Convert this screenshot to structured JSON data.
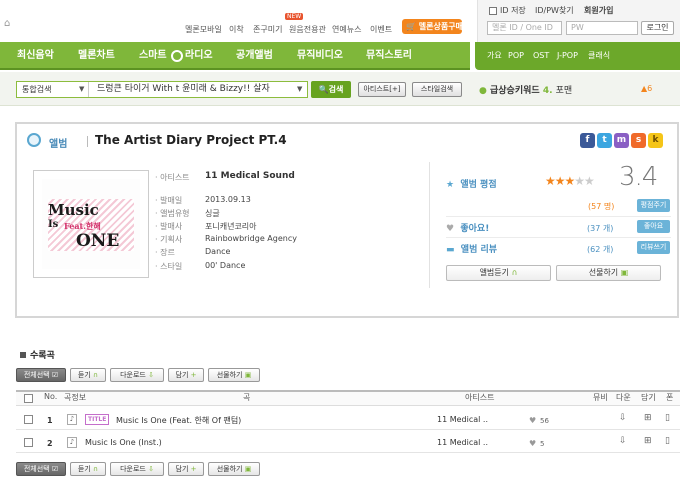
{
  "top": {
    "home_icon": "home-icon",
    "links": [
      "멜론모바일",
      "이착",
      "존구미기",
      "원음전용관",
      "연예뉴스",
      "이벤트"
    ],
    "new_badge": "NEW",
    "buy_button": "멜론상품구매"
  },
  "login": {
    "save_id": "ID 저장",
    "find": "ID/PW찾기",
    "join": "회원가입",
    "id_placeholder": "멜론 ID / One ID",
    "pw_placeholder": "PW",
    "login_button": "로그인"
  },
  "nav": {
    "items": [
      "최신음악",
      "멜론차트",
      "스마트",
      "라디오",
      "공개앨범",
      "뮤직비디오",
      "뮤직스토리"
    ],
    "genres": [
      "가요",
      "POP",
      "OST",
      "J-POP",
      "클래식"
    ]
  },
  "search": {
    "type": "통합검색",
    "query": "드렁큰 타이거 With t 윤미래 & Bizzy!! 살자",
    "search_button": "검색",
    "artist_button": "아티스트[+]",
    "style_button": "스타일검색",
    "hot_label": "급상승키워드",
    "hot_rank": "4.",
    "hot_word": "포맨",
    "hot_change": "6"
  },
  "album": {
    "section_label": "앨범",
    "title": "The Artist Diary Project PT.4",
    "share_icons": [
      "f",
      "t",
      "m",
      "s",
      "k"
    ],
    "cover_text": [
      "Music",
      "Is",
      "Feat.한해",
      "ONE"
    ],
    "details": [
      {
        "label": "아티스트",
        "value": "11 Medical Sound"
      },
      {
        "label": "발매일",
        "value": "2013.09.13"
      },
      {
        "label": "앨범유형",
        "value": "싱글"
      },
      {
        "label": "발매사",
        "value": "포니캐년코리아"
      },
      {
        "label": "기획사",
        "value": "Rainbowbridge Agency"
      },
      {
        "label": "장르",
        "value": "Dance"
      },
      {
        "label": "스타일",
        "value": "00' Dance"
      }
    ],
    "rating_label": "앨범 평점",
    "rating_score": "3.4",
    "rating_value": 3.4,
    "rating_count": "(57 명)",
    "rating_button": "평점주기",
    "like_label": "좋아요!",
    "like_count": "(37 개)",
    "like_button": "좋아요",
    "review_label": "앨범 리뷰",
    "review_count": "(62 개)",
    "review_button": "리뷰쓰기",
    "listen_button": "앨범듣기",
    "gift_button": "선물하기"
  },
  "tracks": {
    "section_label": "수록곡",
    "actions": [
      "전체선택",
      "듣기",
      "다운로드",
      "담기",
      "선물하기"
    ],
    "headers": [
      "No.",
      "곡정보",
      "곡",
      "아티스트",
      "뮤비",
      "다운",
      "담기",
      "폰"
    ],
    "rows": [
      {
        "no": "1",
        "tag": "TITLE",
        "title": "Music Is One (Feat. 한해 Of 팬텀)",
        "artist": "11 Medical ..",
        "likes": "56"
      },
      {
        "no": "2",
        "tag": "",
        "title": "Music Is One (Inst.)",
        "artist": "11 Medical ..",
        "likes": "5"
      }
    ]
  },
  "colors": {
    "brand_green": "#7fb73a",
    "accent_orange": "#f3851d",
    "info_blue": "#4a90c0"
  }
}
